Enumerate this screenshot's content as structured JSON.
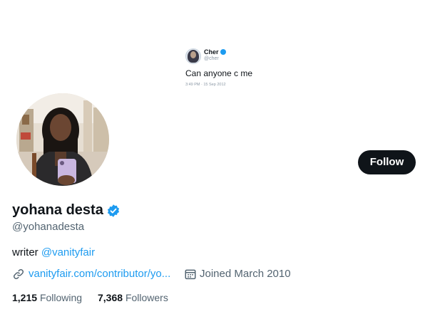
{
  "banner": {
    "tweet": {
      "name": "Cher",
      "handle": "@cher",
      "text": "Can anyone c me",
      "timestamp": "3:49 PM · 15 Sep 2012"
    }
  },
  "profile": {
    "follow_label": "Follow",
    "display_name": "yohana desta",
    "handle": "@yohanadesta",
    "bio_prefix": "writer ",
    "bio_mention": "@vanityfair",
    "website": "vanityfair.com/contributor/yo...",
    "joined": "Joined March 2010",
    "following_count": "1,215",
    "following_label": "Following",
    "followers_count": "7,368",
    "followers_label": "Followers"
  },
  "icons": [
    "verified-icon",
    "link-icon",
    "calendar-icon"
  ],
  "colors": {
    "accent": "#1d9bf0",
    "button": "#0f1419",
    "muted": "#536471"
  }
}
